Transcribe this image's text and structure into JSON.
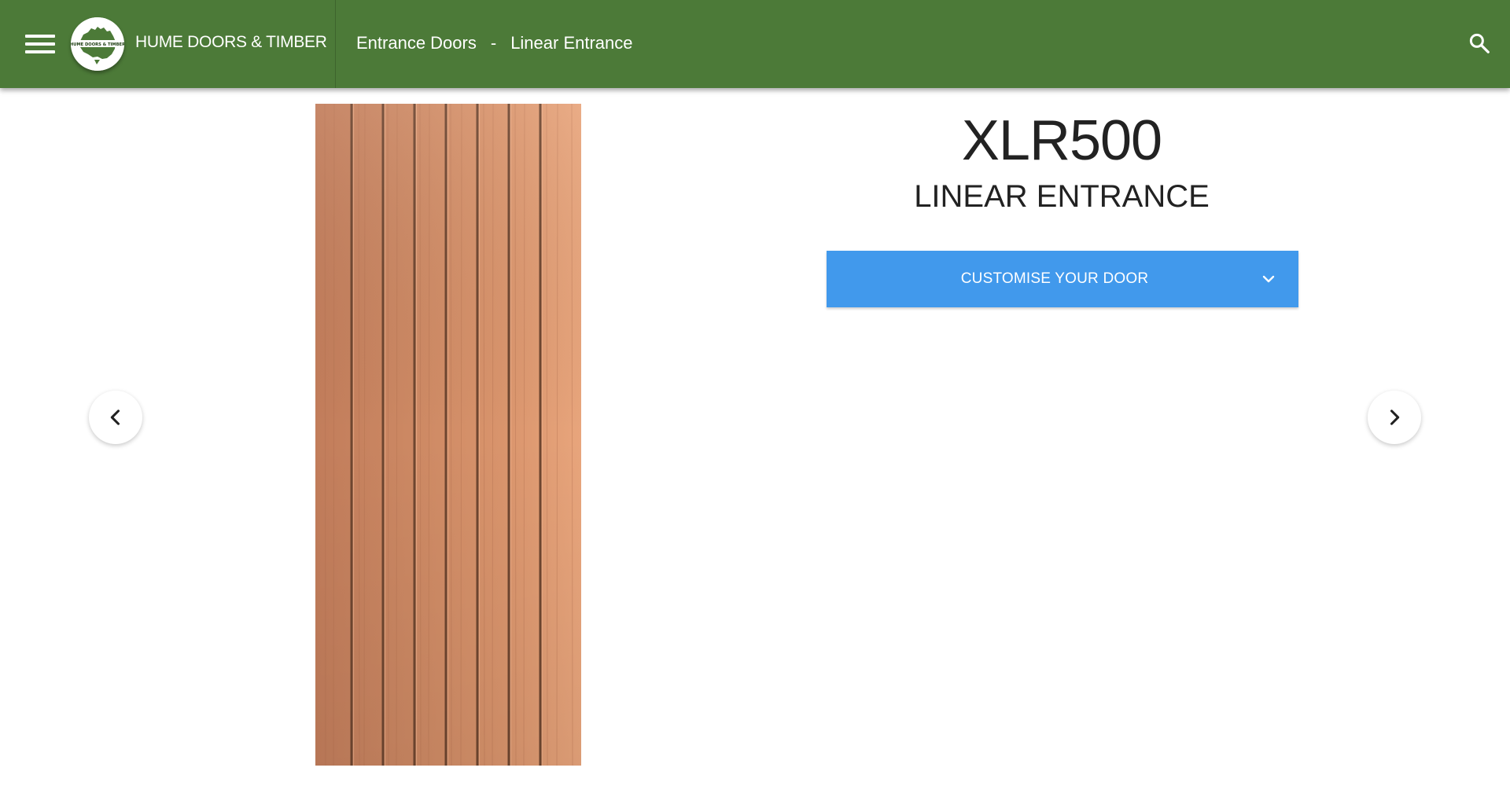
{
  "header": {
    "brand": "HUME DOORS & TIMBER",
    "logo_text": "HUME DOORS & TIMBER",
    "breadcrumb": {
      "items": [
        "Entrance Doors",
        "Linear Entrance"
      ],
      "separator": "-"
    },
    "background_color": "#4c7a38"
  },
  "icons": {
    "menu": "hamburger-icon",
    "search": "search-icon",
    "prev": "chevron-left-icon",
    "next": "chevron-right-icon",
    "dropdown": "chevron-down-icon"
  },
  "product": {
    "code": "XLR500",
    "name": "LINEAR ENTRANCE",
    "customise_label": "CUSTOMISE YOUR DOOR",
    "button_color": "#4199ec"
  }
}
